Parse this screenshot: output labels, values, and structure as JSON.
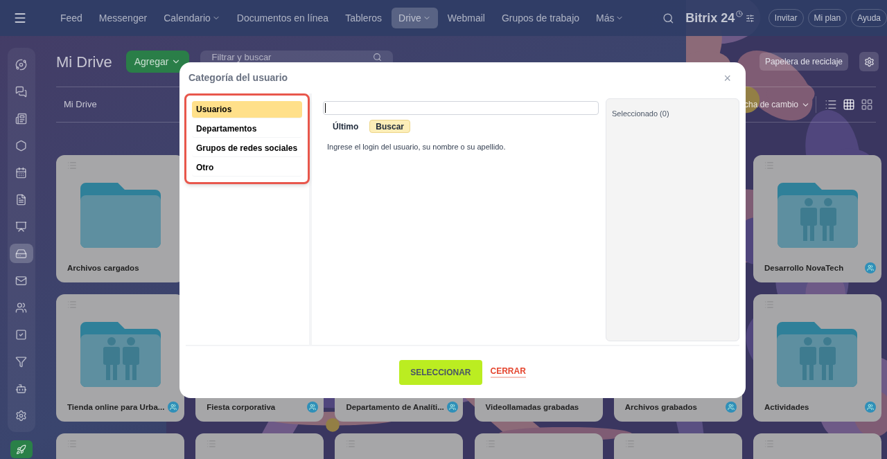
{
  "top_bar": {
    "nav": [
      {
        "label": "Feed",
        "selected": false,
        "dropdown": false
      },
      {
        "label": "Messenger",
        "selected": false,
        "dropdown": false
      },
      {
        "label": "Calendario",
        "selected": false,
        "dropdown": true
      },
      {
        "label": "Documentos en línea",
        "selected": false,
        "dropdown": false
      },
      {
        "label": "Tableros",
        "selected": false,
        "dropdown": false
      },
      {
        "label": "Drive",
        "selected": true,
        "dropdown": true
      },
      {
        "label": "Webmail",
        "selected": false,
        "dropdown": false
      },
      {
        "label": "Grupos de trabajo",
        "selected": false,
        "dropdown": false
      },
      {
        "label": "Más",
        "selected": false,
        "dropdown": true
      }
    ],
    "logo": "Bitrix 24",
    "buttons": [
      "Invitar",
      "Mi plan",
      "Ayuda"
    ]
  },
  "sidebar": {
    "items": [
      {
        "selected": false
      },
      {
        "selected": false
      },
      {
        "selected": false
      },
      {
        "selected": false
      },
      {
        "selected": false
      },
      {
        "selected": false
      },
      {
        "selected": false
      },
      {
        "selected": true
      },
      {
        "selected": false
      },
      {
        "selected": false
      },
      {
        "selected": false
      },
      {
        "selected": false
      },
      {
        "selected": false
      },
      {
        "selected": false
      }
    ]
  },
  "header": {
    "title": "Mi Drive",
    "add_button": "Agregar",
    "filter": {
      "placeholder": "Filtrar y buscar"
    },
    "trash_button": "Papelera de reciclaje"
  },
  "toolbar": {
    "breadcrumb": "Mi Drive",
    "sort": "cha de cambio"
  },
  "cards_row_1": [
    {
      "name": "Archivos cargados",
      "kind": "plain",
      "shared": false
    },
    {
      "name": "Desarrollo NovaTech",
      "kind": "group",
      "shared": true
    }
  ],
  "cards_row_2": [
    {
      "name": "Tienda online para Urba...",
      "kind": "group",
      "shared": true
    },
    {
      "name": "Fiesta corporativa",
      "shared": true
    },
    {
      "name": "Departamento de Analíti...",
      "shared": true
    },
    {
      "name": "Videollamadas grabadas",
      "shared": false
    },
    {
      "name": "Archivos grabados",
      "shared": true
    },
    {
      "name": "Actividades",
      "kind": "group",
      "shared": true
    }
  ],
  "dialog": {
    "title": "Categoría del usuario",
    "close": "×",
    "categories": [
      {
        "label": "Usuarios",
        "selected": true
      },
      {
        "label": "Departamentos",
        "selected": false
      },
      {
        "label": "Grupos de redes sociales",
        "selected": false
      },
      {
        "label": "Otro",
        "selected": false
      }
    ],
    "tabs": [
      {
        "label": "Último",
        "selected": false
      },
      {
        "label": "Buscar",
        "selected": true
      }
    ],
    "hint": "Ingrese el login del usuario, su nombre o su apellido.",
    "selected_panel": "Seleccionado (0)",
    "primary_button": "SELECCIONAR",
    "secondary_button": "CERRAR"
  }
}
